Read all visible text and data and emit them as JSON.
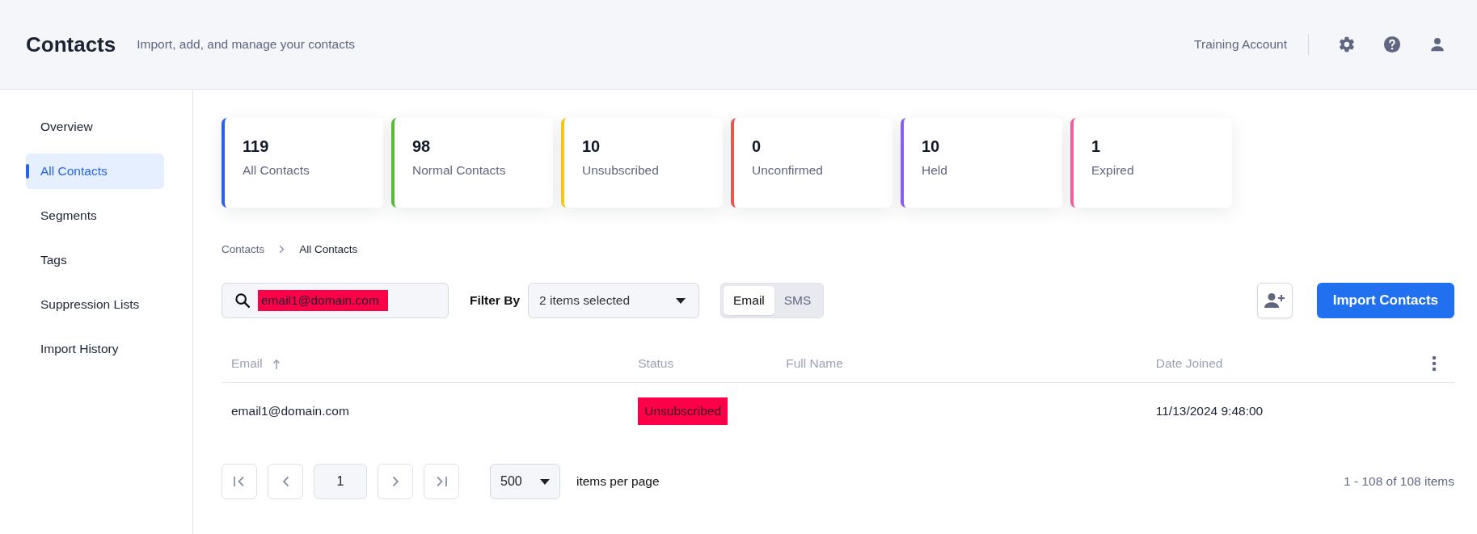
{
  "header": {
    "title": "Contacts",
    "subtitle": "Import, add, and manage your contacts",
    "account": "Training Account"
  },
  "sidebar": {
    "items": [
      {
        "label": "Overview",
        "selected": false
      },
      {
        "label": "All Contacts",
        "selected": true
      },
      {
        "label": "Segments",
        "selected": false
      },
      {
        "label": "Tags",
        "selected": false
      },
      {
        "label": "Suppression Lists",
        "selected": false
      },
      {
        "label": "Import History",
        "selected": false
      }
    ]
  },
  "stats": [
    {
      "value": "119",
      "label": "All Contacts",
      "color": "#2563eb"
    },
    {
      "value": "98",
      "label": "Normal Contacts",
      "color": "#5cb83c"
    },
    {
      "value": "10",
      "label": "Unsubscribed",
      "color": "#f5c518"
    },
    {
      "value": "0",
      "label": "Unconfirmed",
      "color": "#ef5350"
    },
    {
      "value": "10",
      "label": "Held",
      "color": "#8b5cf6"
    },
    {
      "value": "1",
      "label": "Expired",
      "color": "#ec5f9a"
    }
  ],
  "breadcrumb": [
    "Contacts",
    "All Contacts"
  ],
  "search": {
    "value": "email1@domain.com",
    "highlighted": true
  },
  "filter": {
    "label": "Filter By",
    "value": "2 items selected"
  },
  "channel_tabs": [
    {
      "label": "Email",
      "selected": true
    },
    {
      "label": "SMS",
      "selected": false
    }
  ],
  "import_button": "Import Contacts",
  "table": {
    "columns": [
      {
        "label": "Email",
        "sorted": true
      },
      {
        "label": "Status",
        "sorted": false
      },
      {
        "label": "Full Name",
        "sorted": false
      },
      {
        "label": "Date Joined",
        "sorted": false
      }
    ],
    "rows": [
      {
        "email": "email1@domain.com",
        "status": "Unsubscribed",
        "status_highlighted": true,
        "full_name": "",
        "date_joined": "11/13/2024 9:48:00"
      }
    ]
  },
  "pager": {
    "page": "1",
    "page_size": "500",
    "page_size_label": "items per page",
    "summary": "1 - 108 of 108 items"
  }
}
